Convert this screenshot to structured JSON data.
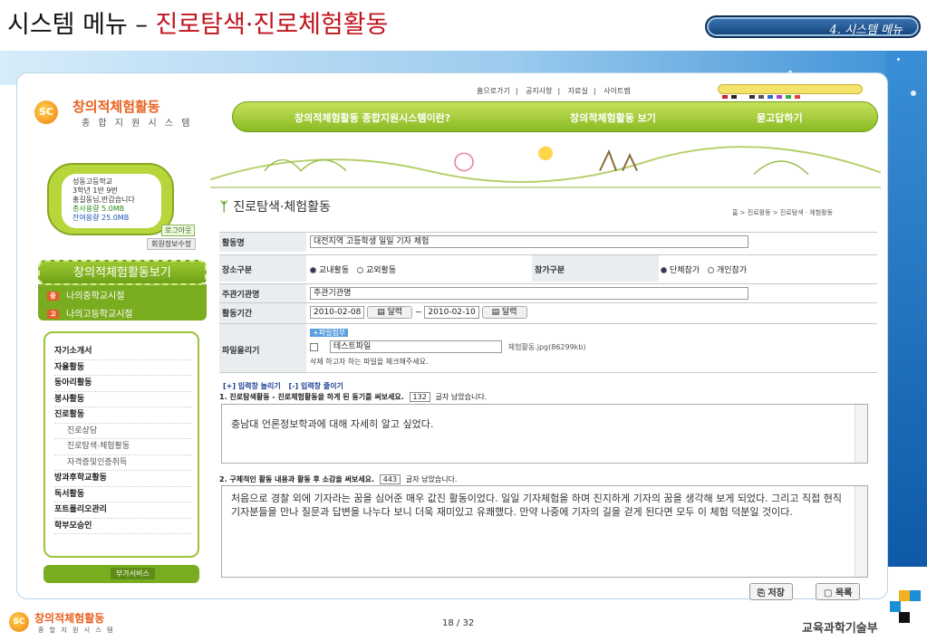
{
  "slide": {
    "title_main": "시스템 메뉴 – ",
    "title_accent": "진로탐색·진로체험활동",
    "tag": "4. 시스템 메뉴",
    "page": "18 / 32",
    "ministry": "교육과학기술부"
  },
  "site": {
    "logo_title": "창의적체험활동",
    "logo_sub": "종 합 지 원 시 스 템",
    "logo_mark": "SC",
    "top_links": [
      "홈으로가기",
      "공지사항",
      "자료실",
      "사이트맵"
    ],
    "nav": [
      "창의적체험활동 종합지원시스템이란?",
      "창의적체험활동 보기",
      "묻고답하기"
    ]
  },
  "profile": {
    "school": "성동고등학교",
    "class": "3학년 1반 9번",
    "greeting": "홍길동님,반갑습니다",
    "usage": "총사용량 5.0MB",
    "remain": "잔여용량 25.0MB",
    "logout": "로그아웃",
    "edit": "회원정보수정"
  },
  "sidebar": {
    "header": "창의적체험활동보기",
    "schools": [
      "나의중학교시절",
      "나의고등학교시절"
    ],
    "school_marks": [
      "중",
      "고"
    ],
    "menu": [
      {
        "label": "자기소개서",
        "type": "bold"
      },
      {
        "label": "자율활동",
        "type": "bold"
      },
      {
        "label": "동아리활동",
        "type": "bold"
      },
      {
        "label": "봉사활동",
        "type": "bold"
      },
      {
        "label": "진로활동",
        "type": "bold"
      },
      {
        "label": "진로상담",
        "type": "sub"
      },
      {
        "label": "진로탐색·체험활동",
        "type": "sub"
      },
      {
        "label": "자격증및인증취득",
        "type": "sub"
      },
      {
        "label": "방과후학교활동",
        "type": "bold"
      },
      {
        "label": "독서활동",
        "type": "bold"
      },
      {
        "label": "포트폴리오관리",
        "type": "bold"
      },
      {
        "label": "학부모승인",
        "type": "bold"
      }
    ],
    "service": "부가서비스"
  },
  "page": {
    "title": "진로탐색·체험활동",
    "breadcrumb": "홈 > 진로활동 > 진로탐색 · 체험활동"
  },
  "form": {
    "activity_name_label": "활동명",
    "activity_name": "대전지역 고등학생 일일 기자 체험",
    "place_label": "장소구분",
    "place_options": [
      "교내활동",
      "교외활동"
    ],
    "participation_label": "참가구분",
    "participation_options": [
      "단체참가",
      "개인참가"
    ],
    "host_label": "주관기관명",
    "host": "주관기관명",
    "period_label": "활동기간",
    "start_date": "2010-02-08",
    "end_date": "2010-02-10",
    "tilde": "~",
    "calendar_label": "달력",
    "file_label": "파일올리기",
    "file_attach": "+파일첨부",
    "file_name": "테스트파일",
    "file_info": "체험활동.jpg(86299kb)",
    "file_note": "삭제 하고자 하는 파일을 체크해주세요.",
    "expand": "[+] 입력창 늘리기",
    "shrink": "[-] 입력창 줄이기",
    "q1": "1. 진로탐색활동 - 진로체험활동을 하게 된 동기를 써보세요.",
    "q1_count": "132",
    "remaining": "글자 남았습니다.",
    "a1": "충남대 언론정보학과에 대해 자세히 알고 싶었다.",
    "q2": "2. 구체적인 활동 내용과 활동 후 소감을 써보세요.",
    "q2_count": "443",
    "a2": "처음으로 경찰 외에 기자라는 꿈을 심어준 매우 값진 활동이었다. 일일 기자체험을 하며 진지하게 기자의 꿈을 생각해 보게 되었다. 그리고 직접 현직 기자분들을 만나 질문과 답변을 나누다 보니 더욱 재미있고 유쾌했다. 만약 나중에 기자의 길을 걷게 된다면 모두 이 체험 덕분일 것이다.",
    "save": "저장",
    "list": "목록"
  },
  "colors": {
    "accent_red": "#c0141c",
    "nav_green": "#88bb22",
    "tag_blue": "#12427a"
  }
}
